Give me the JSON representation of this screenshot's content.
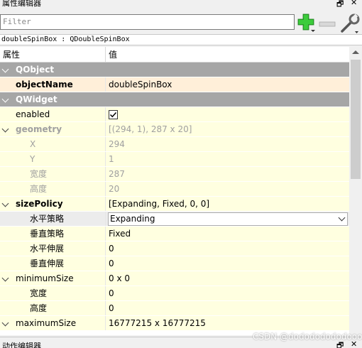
{
  "window": {
    "title": "属性编辑器",
    "float_btn": "🗗",
    "close_btn": "✕"
  },
  "toolbar": {
    "filter_placeholder": "Filter",
    "add_icon": "plus-icon",
    "remove_icon": "minus-icon",
    "config_icon": "wrench-icon"
  },
  "class_line": "doubleSpinBox : QDoubleSpinBox",
  "table": {
    "col_property": "属性",
    "col_value": "值",
    "rows": [
      {
        "name": "QObject",
        "value": ""
      },
      {
        "name": "objectName",
        "value": "doubleSpinBox"
      },
      {
        "name": "QWidget",
        "value": ""
      },
      {
        "name": "enabled",
        "value": ""
      },
      {
        "name": "geometry",
        "value": "[(294, 1), 287 x 20]"
      },
      {
        "name": "X",
        "value": "294"
      },
      {
        "name": "Y",
        "value": "1"
      },
      {
        "name": "宽度",
        "value": "287"
      },
      {
        "name": "高度",
        "value": "20"
      },
      {
        "name": "sizePolicy",
        "value": "[Expanding, Fixed, 0, 0]"
      },
      {
        "name": "水平策略",
        "value": "Expanding"
      },
      {
        "name": "垂直策略",
        "value": "Fixed"
      },
      {
        "name": "水平伸展",
        "value": "0"
      },
      {
        "name": "垂直伸展",
        "value": "0"
      },
      {
        "name": "minimumSize",
        "value": "0 x 0"
      },
      {
        "name": "宽度",
        "value": "0"
      },
      {
        "name": "高度",
        "value": "0"
      },
      {
        "name": "maximumSize",
        "value": "16777215 x 16777215"
      }
    ]
  },
  "enabled_checked": true,
  "bottom_panel": {
    "title": "动作编辑器",
    "float_btn": "🗗",
    "close_btn": "✕"
  },
  "watermark": "CSDN @dodododododooo",
  "colors": {
    "group_bg": "#a6a6a6",
    "row_yellow": "#ffffe0",
    "row_orange": "#ffefd9",
    "add_green": "#2fb52f"
  }
}
